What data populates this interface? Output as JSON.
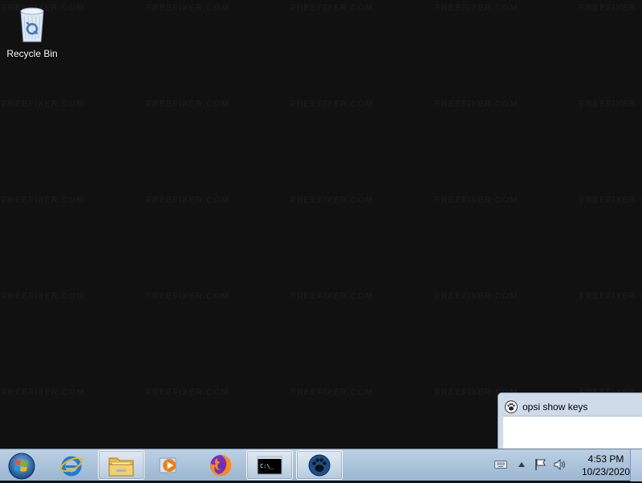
{
  "watermark": {
    "text": "FREEFIXER.COM"
  },
  "desktop": {
    "icons": [
      {
        "label": "Recycle Bin",
        "icon": "recycle-bin-icon"
      }
    ]
  },
  "popup": {
    "title": "opsi show keys",
    "icon": "paw-icon"
  },
  "taskbar": {
    "start": {
      "icon": "windows-start-orb-icon"
    },
    "items": [
      {
        "icon": "internet-explorer-icon",
        "open": false
      },
      {
        "icon": "file-explorer-folder-icon",
        "open": true
      },
      {
        "icon": "media-player-icon",
        "open": false
      },
      {
        "icon": "firefox-icon",
        "open": false
      },
      {
        "icon": "command-prompt-icon",
        "open": true,
        "glyph": "C:\\_"
      },
      {
        "icon": "opsi-paw-icon",
        "open": true
      }
    ],
    "tray": {
      "icons": [
        "keyboard-icon",
        "show-hidden-arrow-icon",
        "action-center-flag-icon",
        "speaker-icon"
      ],
      "time": "4:53 PM",
      "date": "10/23/2020"
    }
  }
}
